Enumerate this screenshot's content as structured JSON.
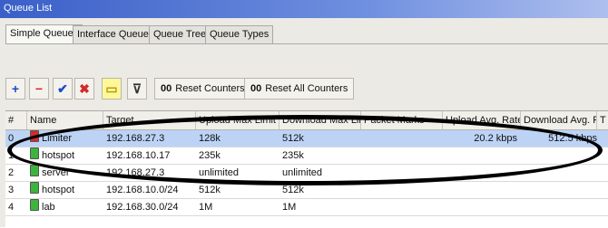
{
  "window": {
    "title": "Queue List"
  },
  "tabs": [
    "Simple Queues",
    "Interface Queues",
    "Queue Tree",
    "Queue Types"
  ],
  "toolbar": {
    "icons": [
      "add-icon",
      "remove-icon",
      "enable-icon",
      "disable-icon",
      "comment-icon",
      "filter-icon"
    ],
    "glyphs": {
      "add": "+",
      "remove": "−",
      "enable": "✔",
      "disable": "✖",
      "comment": "▭",
      "filter": "⊽"
    },
    "reset_counters": {
      "prefix": "00",
      "label": "Reset Counters"
    },
    "reset_all_counters": {
      "prefix": "00",
      "label": "Reset All Counters"
    }
  },
  "table": {
    "columns": [
      "#",
      "Name",
      "Target",
      "Upload Max Limit",
      "Download Max Limit",
      "Packet Marks",
      "Upload Avg. Rate",
      "Download Avg. R...",
      "T"
    ],
    "rows": [
      {
        "num": "0",
        "name": "Limiter",
        "target": "192.168.27.3",
        "upload_max": "128k",
        "download_max": "512k",
        "packet_marks": "",
        "upload_avg": "20.2 kbps",
        "download_avg": "512.5 kbps",
        "icon": "red",
        "selected": true
      },
      {
        "num": "1",
        "name": "hotspot",
        "target": "192.168.10.17",
        "upload_max": "235k",
        "download_max": "235k",
        "packet_marks": "",
        "upload_avg": "",
        "download_avg": "",
        "icon": "green",
        "selected": false
      },
      {
        "num": "2",
        "name": "server",
        "target": "192.168.27.3",
        "upload_max": "unlimited",
        "download_max": "unlimited",
        "packet_marks": "",
        "upload_avg": "",
        "download_avg": "",
        "icon": "green",
        "selected": false
      },
      {
        "num": "3",
        "name": "hotspot",
        "target": "192.168.10.0/24",
        "upload_max": "512k",
        "download_max": "512k",
        "packet_marks": "",
        "upload_avg": "",
        "download_avg": "",
        "icon": "green",
        "selected": false
      },
      {
        "num": "4",
        "name": "lab",
        "target": "192.168.30.0/24",
        "upload_max": "1M",
        "download_max": "1M",
        "packet_marks": "",
        "upload_avg": "",
        "download_avg": "",
        "icon": "green",
        "selected": false
      }
    ]
  },
  "colors": {
    "selected_row": "#bcd3f6",
    "title_bar": "#3a5fc8",
    "annotation": "#000000"
  }
}
